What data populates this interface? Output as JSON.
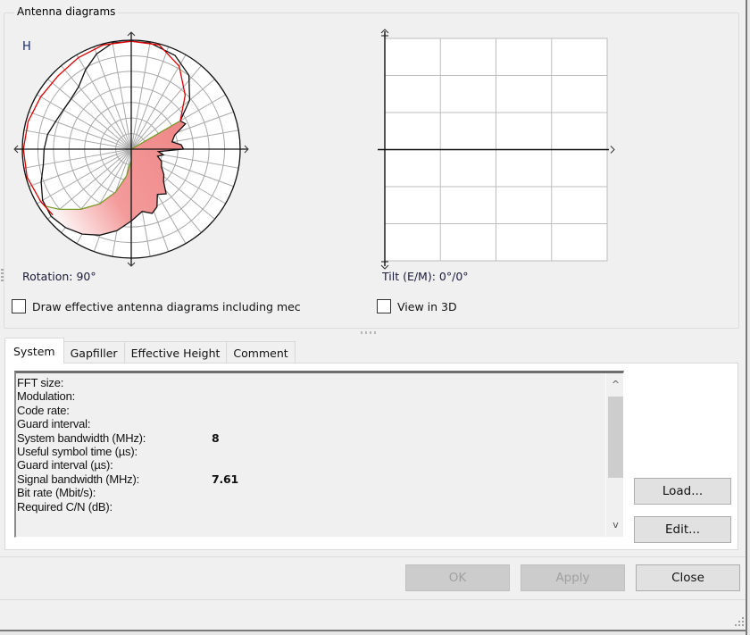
{
  "group": {
    "title": "Antenna diagrams"
  },
  "horizontal_diagram": {
    "label": "H",
    "caption": "Rotation: 90°",
    "rotation_deg": 90
  },
  "vertical_diagram": {
    "caption": "Tilt (E/M): 0°/0°"
  },
  "options": {
    "draw_effective_label": "Draw effective antenna diagrams including mec",
    "draw_effective_checked": false,
    "view_3d_label": "View in 3D",
    "view_3d_checked": false
  },
  "tabs": [
    {
      "label": "System",
      "active": true
    },
    {
      "label": "Gapfiller",
      "active": false
    },
    {
      "label": "Effective Height",
      "active": false
    },
    {
      "label": "Comment",
      "active": false
    }
  ],
  "system_info": [
    {
      "key": "FFT size:",
      "value": ""
    },
    {
      "key": "Modulation:",
      "value": ""
    },
    {
      "key": "Code rate:",
      "value": ""
    },
    {
      "key": "Guard interval:",
      "value": ""
    },
    {
      "key": "System bandwidth (MHz):",
      "value": "8"
    },
    {
      "key": "Useful symbol time (µs):",
      "value": ""
    },
    {
      "key": "Guard interval (µs):",
      "value": ""
    },
    {
      "key": "Signal bandwidth (MHz):",
      "value": "7.61"
    },
    {
      "key": "Bit rate (Mbit/s):",
      "value": ""
    },
    {
      "key": "Required C/N (dB):",
      "value": ""
    }
  ],
  "scroll": {
    "up_glyph": "^",
    "down_glyph": "v"
  },
  "side_buttons": {
    "load": "Load...",
    "edit": "Edit..."
  },
  "dialog_buttons": {
    "ok": "OK",
    "apply": "Apply",
    "close": "Close",
    "ok_enabled": false,
    "apply_enabled": false
  },
  "colors": {
    "pattern_red": "#e00000",
    "pattern_black": "#111111",
    "pattern_green": "#7a9a2a",
    "fill_pink": "#f08a8a",
    "grid": "#a8a8a8"
  }
}
